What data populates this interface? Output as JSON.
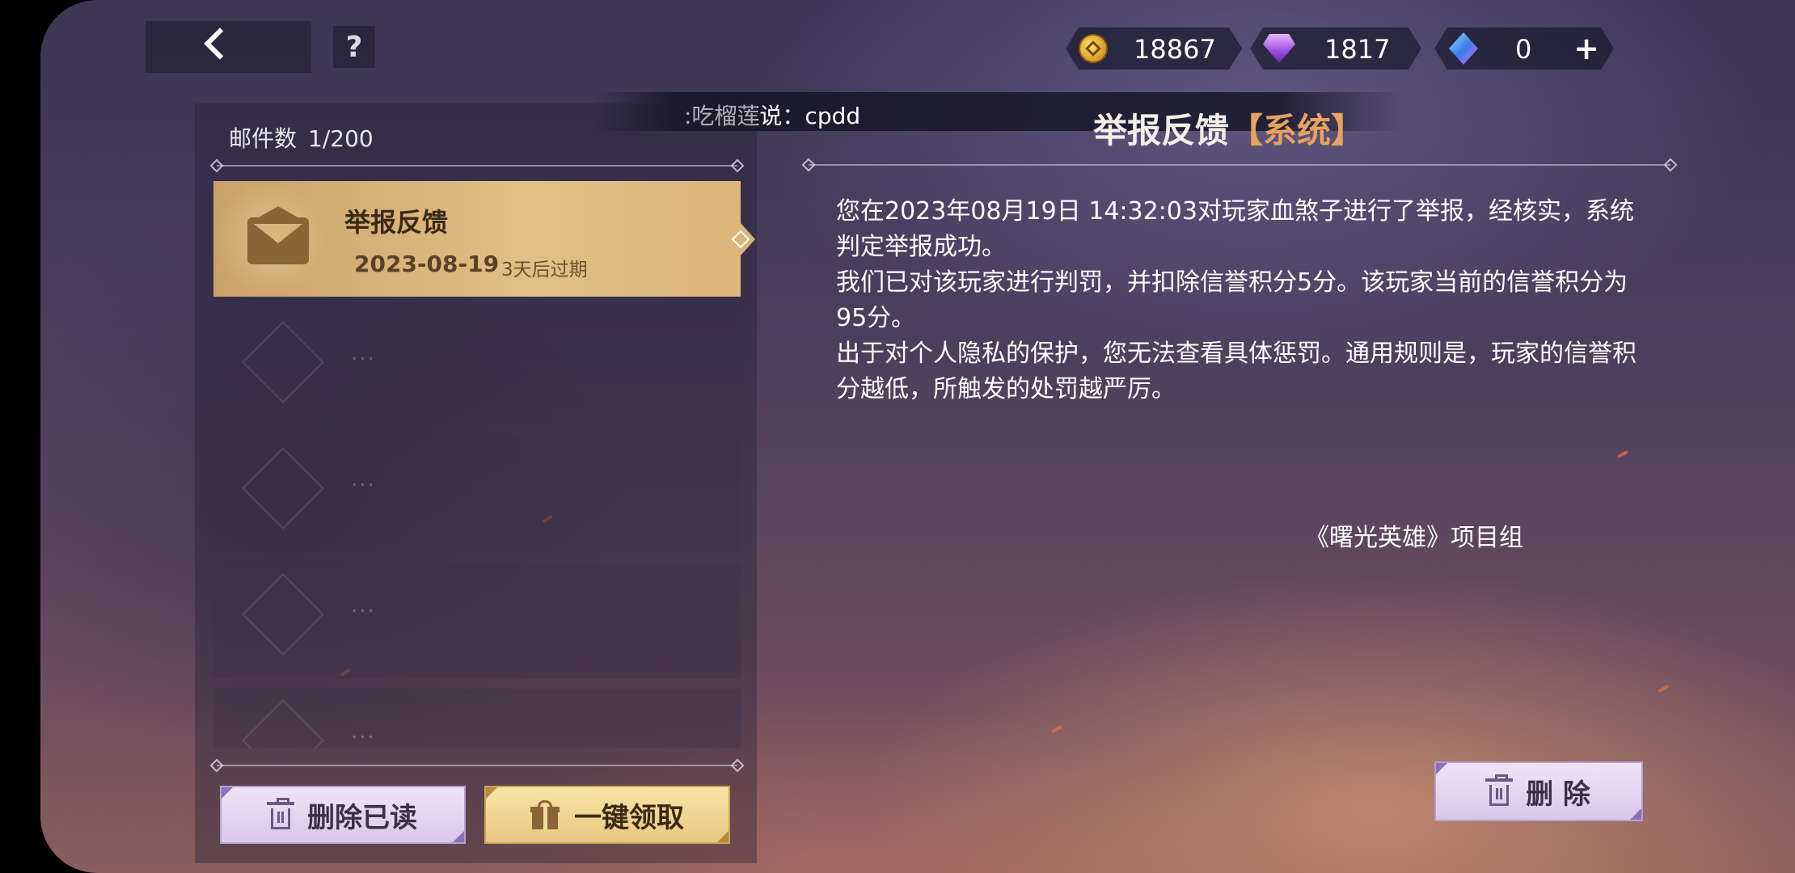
{
  "topbar": {
    "back_icon": "back-chevron",
    "help_label": "?",
    "resources": [
      {
        "icon": "gold-coin",
        "value": "18867"
      },
      {
        "icon": "purple-gem",
        "value": "1817"
      },
      {
        "icon": "blue-crystal",
        "value": "0"
      }
    ],
    "add_label": "+"
  },
  "broadcast": {
    "text": ":吃榴莲说：cpdd"
  },
  "mailbox": {
    "count_label": "邮件数",
    "count_value": "1/200",
    "items": [
      {
        "title": "举报反馈",
        "date": "2023-08-19",
        "expire": "3天后过期",
        "selected": true
      },
      {
        "placeholder": "..."
      },
      {
        "placeholder": "..."
      },
      {
        "placeholder": "..."
      },
      {
        "placeholder": "..."
      }
    ],
    "delete_read_label": "删除已读",
    "claim_all_label": "一键领取"
  },
  "detail": {
    "title": "举报反馈",
    "tag": "【系统】",
    "paragraphs": [
      "您在2023年08月19日 14:32:03对玩家血煞子进行了举报，经核实，系统判定举报成功。",
      "我们已对该玩家进行判罚，并扣除信誉积分5分。该玩家当前的信誉积分为95分。",
      "出于对个人隐私的保护，您无法查看具体惩罚。通用规则是，玩家的信誉积分越低，所触发的处罚越严厉。"
    ],
    "signature": "《曙光英雄》项目组",
    "delete_label": "删 除"
  },
  "colors": {
    "selected_mail": "#dcb57a",
    "tag_accent": "#e7a25e",
    "button_lilac": "#d9c8ea",
    "button_gold": "#e8c880"
  }
}
